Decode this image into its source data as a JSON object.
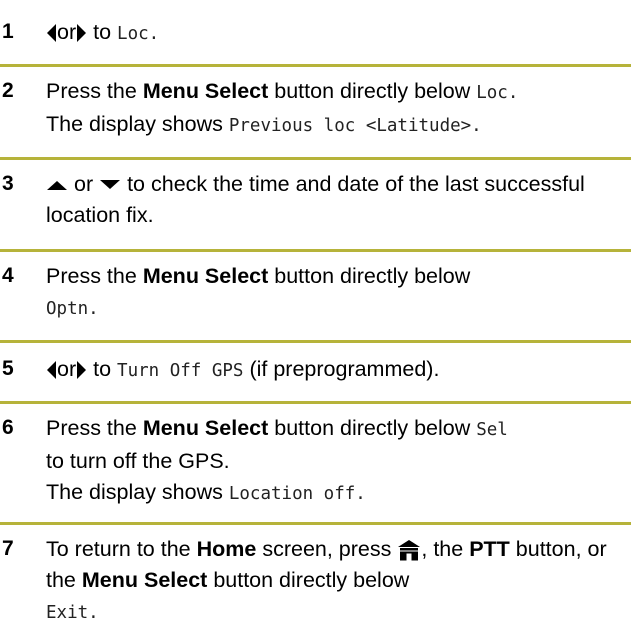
{
  "colors": {
    "rule": "#b6b33a",
    "text": "#000000"
  },
  "steps": [
    {
      "number": "1",
      "icons": [
        "left-arrow-icon",
        "right-arrow-icon"
      ],
      "connector": "or",
      "text_to": "to",
      "code": "Loc."
    },
    {
      "number": "2",
      "line1_prefix": "Press the",
      "bold": "Menu Select",
      "line1_mid": "button directly below",
      "code1": "Loc.",
      "line2_prefix": "The display shows",
      "code2": "Previous loc <Latitude>."
    },
    {
      "number": "3",
      "icons": [
        "up-arrow-icon",
        "down-arrow-icon"
      ],
      "connector": "or",
      "text": "to check the time and date of the last successful location fix."
    },
    {
      "number": "4",
      "prefix": "Press the",
      "bold": "Menu Select",
      "mid": "button directly below",
      "code": "Optn."
    },
    {
      "number": "5",
      "icons": [
        "left-arrow-icon",
        "right-arrow-icon"
      ],
      "connector": "or",
      "text_to": "to",
      "code": "Turn Off GPS",
      "suffix": "(if preprogrammed)."
    },
    {
      "number": "6",
      "prefix": "Press the",
      "bold": "Menu Select",
      "mid": "button directly below",
      "code1": "Sel",
      "tail": "to turn off the GPS.",
      "line3_prefix": "The display shows",
      "code2": "Location off."
    },
    {
      "number": "7",
      "prefix": "To return to the",
      "bold1": "Home",
      "mid1": "screen, press",
      "icon": "home-icon",
      "mid2": ", the",
      "bold2": "PTT",
      "mid3": "button, or the",
      "bold3": "Menu Select",
      "mid4": "button directly below",
      "code": "Exit."
    }
  ]
}
